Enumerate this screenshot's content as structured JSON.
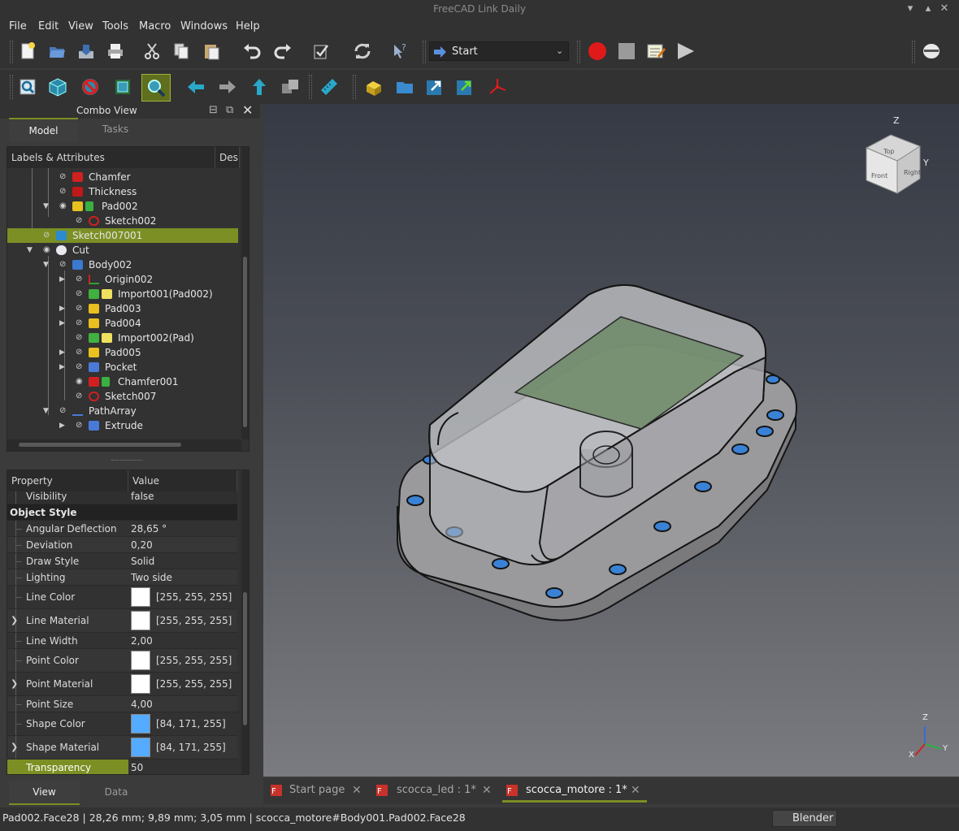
{
  "window": {
    "title": "FreeCAD Link Daily"
  },
  "menu": [
    "File",
    "Edit",
    "View",
    "Tools",
    "Macro",
    "Windows",
    "Help"
  ],
  "toolbar": {
    "workbench": "Start",
    "icons_row1": [
      "new-file-icon",
      "open-file-icon",
      "save-icon",
      "print-icon",
      "cut-icon",
      "copy-icon",
      "paste-icon",
      "undo-icon",
      "redo-icon",
      "refresh-icon",
      "recompute-icon",
      "whats-this-icon",
      "macro-record-icon",
      "macro-stop-icon",
      "macro-edit-icon",
      "macro-run-icon",
      "std-view-icon"
    ],
    "icons_row2": [
      "fit-all-icon",
      "axonometric-icon",
      "draw-style-icon",
      "bounding-box-icon",
      "fit-selection-icon",
      "back-icon",
      "forward-icon",
      "up-icon",
      "box-selection-icon",
      "measure-icon",
      "part-icon",
      "group-icon",
      "link-icon",
      "link-sub-icon",
      "coordinate-icon"
    ]
  },
  "combo_view": {
    "title": "Combo View",
    "tabs": [
      "Model",
      "Tasks"
    ],
    "tree_header": [
      "Labels & Attributes",
      "Des"
    ],
    "tree": [
      {
        "label": "Chamfer",
        "icon": "chamfer-icon"
      },
      {
        "label": "Thickness",
        "icon": "thickness-icon"
      },
      {
        "label": "Pad002",
        "icon": "pad-icon"
      },
      {
        "label": "Sketch002",
        "icon": "sketch-icon"
      },
      {
        "label": "Sketch007001",
        "icon": "body-icon"
      },
      {
        "label": "Cut",
        "icon": "cut-bool-icon"
      },
      {
        "label": "Body002",
        "icon": "body-icon"
      },
      {
        "label": "Origin002",
        "icon": "origin-icon"
      },
      {
        "label": "Import001(Pad002)",
        "icon": "import-icon"
      },
      {
        "label": "Pad003",
        "icon": "pad-icon"
      },
      {
        "label": "Pad004",
        "icon": "pad-icon"
      },
      {
        "label": "Import002(Pad)",
        "icon": "import-icon"
      },
      {
        "label": "Pad005",
        "icon": "pad-icon"
      },
      {
        "label": "Pocket",
        "icon": "pocket-icon"
      },
      {
        "label": "Chamfer001",
        "icon": "chamfer-icon"
      },
      {
        "label": "Sketch007",
        "icon": "sketch-icon"
      },
      {
        "label": "PathArray",
        "icon": "patharray-icon"
      },
      {
        "label": "Extrude",
        "icon": "extrude-icon"
      }
    ],
    "prop_header": [
      "Property",
      "Value"
    ],
    "properties": {
      "visibility": {
        "name": "Visibility",
        "value": "false"
      },
      "group": "Object Style",
      "angular": {
        "name": "Angular Deflection",
        "value": "28,65 °"
      },
      "deviation": {
        "name": "Deviation",
        "value": "0,20"
      },
      "draw_style": {
        "name": "Draw Style",
        "value": "Solid"
      },
      "lighting": {
        "name": "Lighting",
        "value": "Two side"
      },
      "line_color": {
        "name": "Line Color",
        "value": "[255, 255, 255]",
        "color": "#ffffff"
      },
      "line_material": {
        "name": "Line Material",
        "value": "[255, 255, 255]",
        "color": "#ffffff"
      },
      "line_width": {
        "name": "Line Width",
        "value": "2,00"
      },
      "point_color": {
        "name": "Point Color",
        "value": "[255, 255, 255]",
        "color": "#ffffff"
      },
      "point_material": {
        "name": "Point Material",
        "value": "[255, 255, 255]",
        "color": "#ffffff"
      },
      "point_size": {
        "name": "Point Size",
        "value": "4,00"
      },
      "shape_color": {
        "name": "Shape Color",
        "value": "[84, 171, 255]",
        "color": "#54abff"
      },
      "shape_material": {
        "name": "Shape Material",
        "value": "[84, 171, 255]",
        "color": "#54abff"
      },
      "transparency": {
        "name": "Transparency",
        "value": "50"
      }
    },
    "bottom_tabs": [
      "View",
      "Data"
    ]
  },
  "navcube": {
    "top": "Top",
    "front": "Front",
    "right": "Right",
    "axis_z": "Z",
    "axis_y": "Y"
  },
  "axis_indicator": {
    "z": "Z",
    "y": "Y",
    "x": "X"
  },
  "doc_tabs": [
    {
      "label": "Start page"
    },
    {
      "label": "scocca_led : 1*"
    },
    {
      "label": "scocca_motore : 1*"
    }
  ],
  "status": {
    "text": "Pad002.Face28 | 28,26 mm; 9,89 mm; 3,05 mm | scocca_motore#Body001.Pad002.Face28",
    "navigation": "Blender"
  },
  "colors": {
    "accent": "#7b8f24",
    "selection": "#54abff"
  }
}
